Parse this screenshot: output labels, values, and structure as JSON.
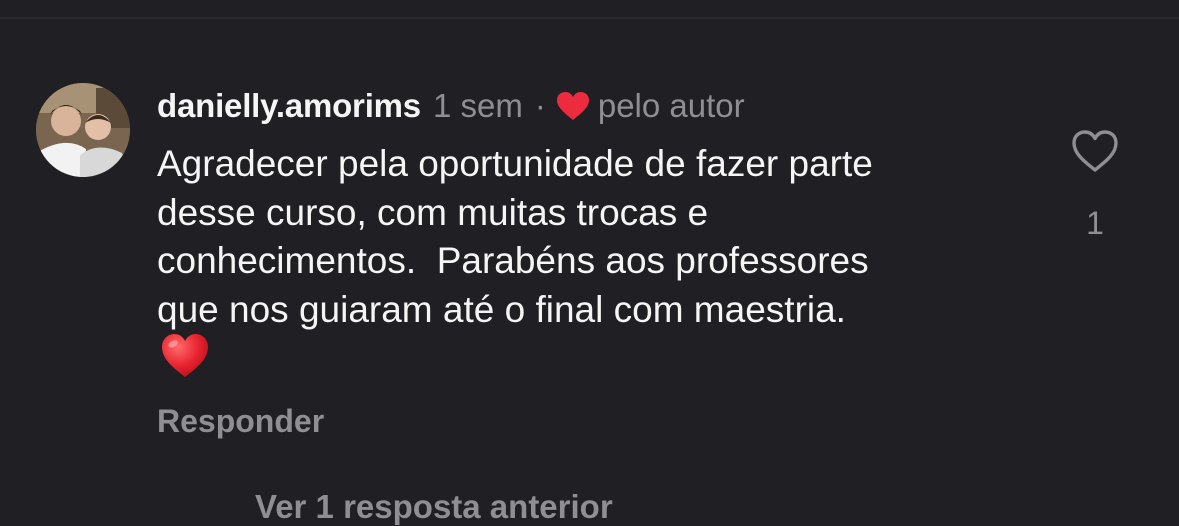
{
  "comment": {
    "username": "danielly.amorims",
    "time": "1 sem",
    "separator": "·",
    "author_like_label": "pelo autor",
    "text": "Agradecer pela oportunidade de fazer parte\ndesse curso, com muitas trocas e\nconhecimentos.  Parabéns aos professores\nque nos guiaram até o final com maestria.",
    "emoji": "heart-emoji",
    "reply_label": "Responder",
    "like_count": "1"
  },
  "replies": {
    "view_more_label": "Ver 1 resposta anterior"
  },
  "colors": {
    "background": "#1f1f24",
    "primary_text": "#f5f5f5",
    "secondary_text": "#8e8e93",
    "heart_red": "#ed2b3e"
  },
  "icons": {
    "author_heart": "heart-filled-icon",
    "like": "heart-outline-icon"
  }
}
